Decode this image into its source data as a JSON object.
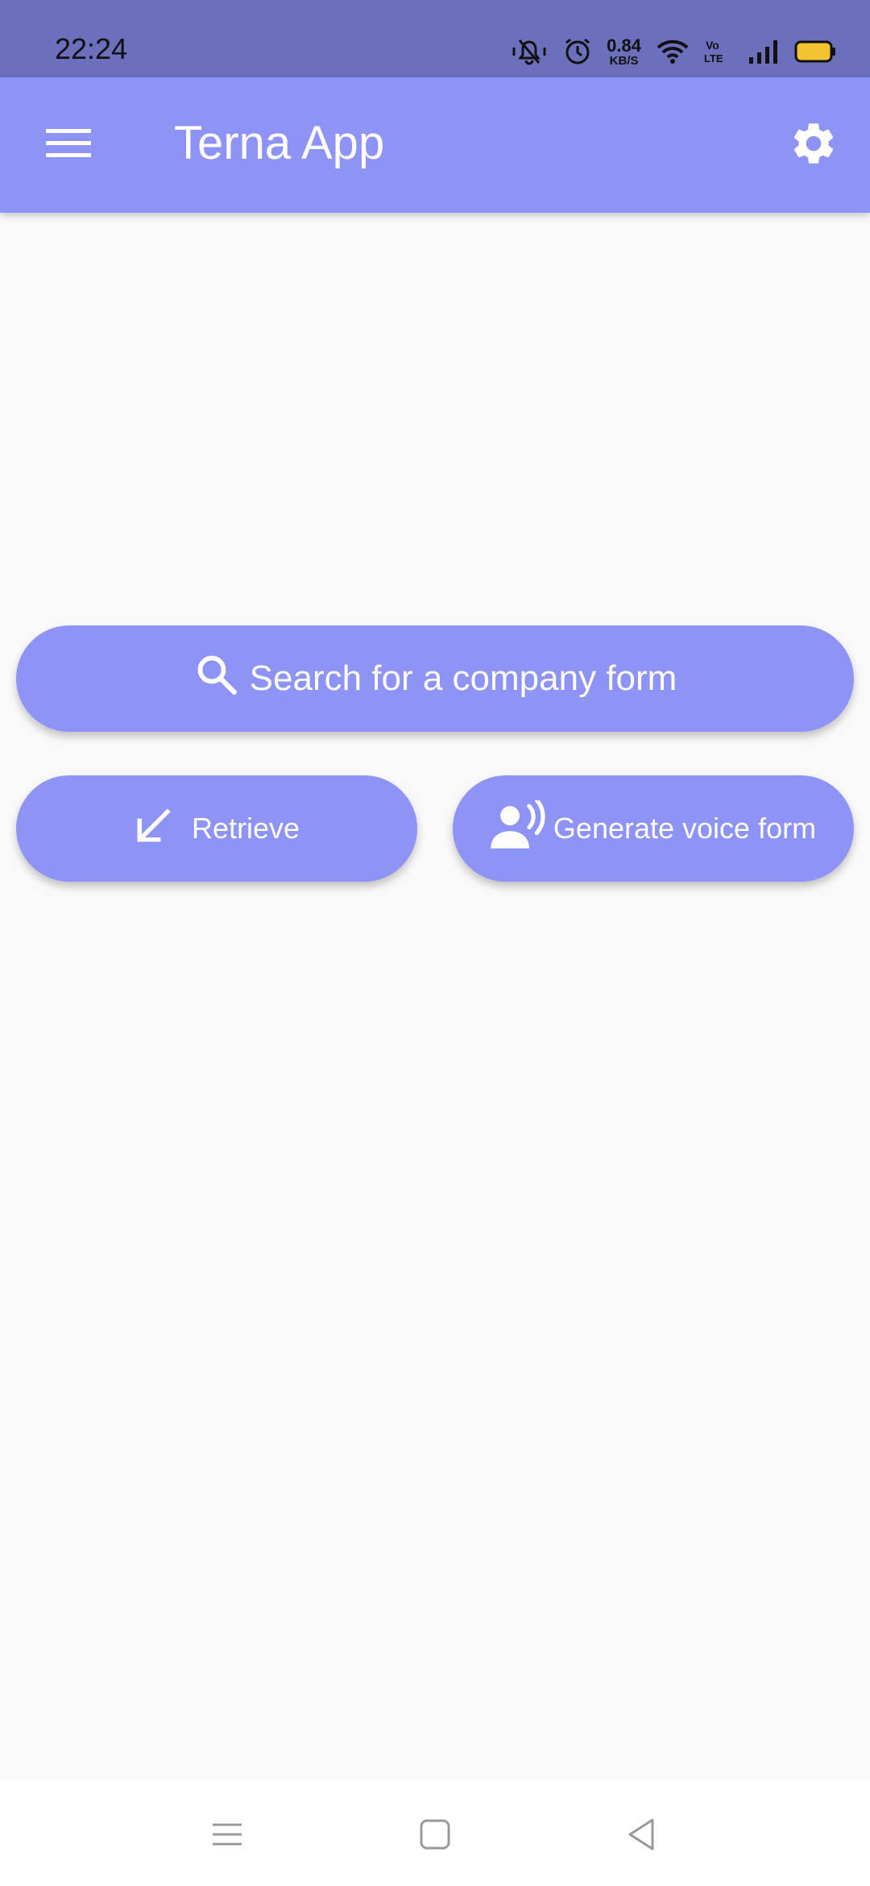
{
  "status_bar": {
    "time": "22:24",
    "net_speed_value": "0.84",
    "net_speed_unit": "KB/S",
    "icons": [
      "mute-vibrate-icon",
      "alarm-icon",
      "wifi-icon",
      "volte-icon",
      "signal-icon",
      "battery-icon"
    ],
    "battery_color": "#f2c230"
  },
  "app_bar": {
    "title": "Terna App",
    "menu_icon": "hamburger-menu-icon",
    "settings_icon": "gear-icon",
    "background": "#8e93f7"
  },
  "actions": {
    "search_label": "Search for a company form",
    "search_icon": "search-icon",
    "retrieve_label": "Retrieve",
    "retrieve_icon": "arrow-down-left-icon",
    "voice_label": "Generate voice form",
    "voice_icon": "voice-person-icon",
    "button_color": "#8e93f7"
  },
  "nav_bar": {
    "icons": [
      "recents-icon",
      "home-icon",
      "back-icon"
    ]
  }
}
